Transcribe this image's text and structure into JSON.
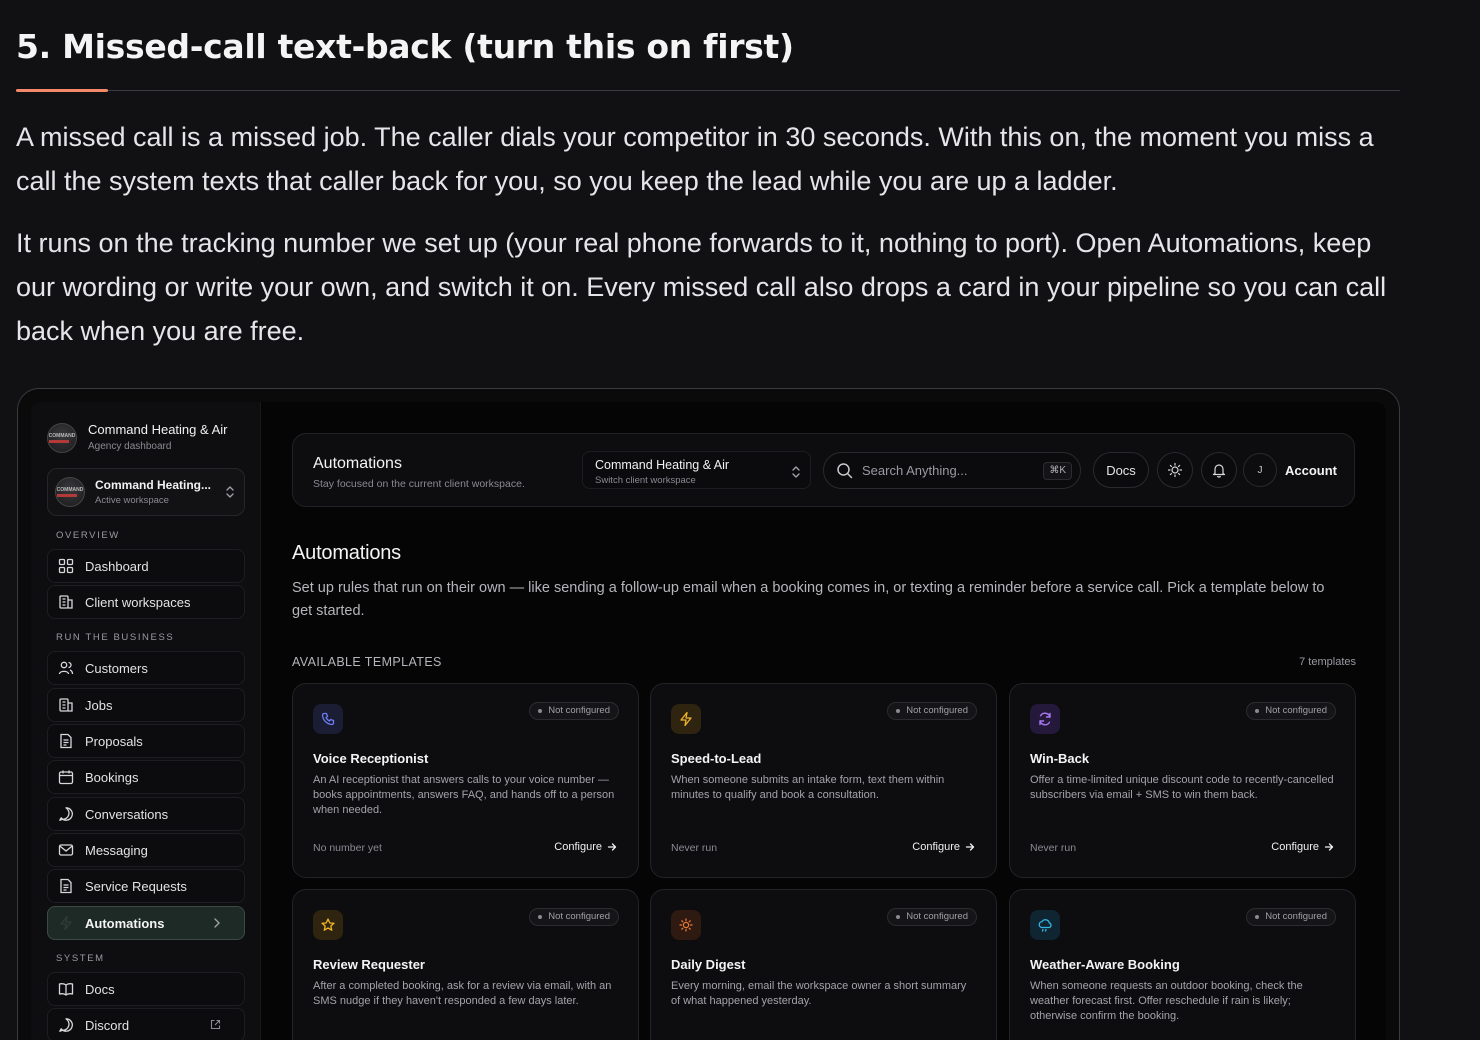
{
  "article": {
    "heading": "5. Missed-call text-back (turn this on first)",
    "p1": "A missed call is a missed job. The caller dials your competitor in 30 seconds. With this on, the moment you miss a call the system texts that caller back for you, so you keep the lead while you are up a ladder.",
    "p2": "It runs on the tracking number we set up (your real phone forwards to it, nothing to port). Open Automations, keep our wording or write your own, and switch it on. Every missed call also drops a card in your pipeline so you can call back when you are free."
  },
  "sidebar": {
    "brand_title": "Command Heating & Air",
    "brand_sub": "Agency dashboard",
    "ws_title": "Command Heating...",
    "ws_sub": "Active workspace",
    "logo_text": "COMMAND",
    "sections": {
      "overview": "OVERVIEW",
      "run": "RUN THE BUSINESS",
      "system": "SYSTEM"
    },
    "items": [
      {
        "label": "Dashboard",
        "icon": "grid-icon"
      },
      {
        "label": "Client workspaces",
        "icon": "building-icon"
      },
      {
        "label": "Customers",
        "icon": "users-icon"
      },
      {
        "label": "Jobs",
        "icon": "building-icon"
      },
      {
        "label": "Proposals",
        "icon": "document-icon"
      },
      {
        "label": "Bookings",
        "icon": "calendar-icon"
      },
      {
        "label": "Conversations",
        "icon": "chat-icon"
      },
      {
        "label": "Messaging",
        "icon": "mail-icon"
      },
      {
        "label": "Service Requests",
        "icon": "document-icon"
      },
      {
        "label": "Automations",
        "icon": "bolt-icon"
      },
      {
        "label": "Docs",
        "icon": "book-icon"
      },
      {
        "label": "Discord",
        "icon": "chat-icon"
      }
    ]
  },
  "topbar": {
    "title": "Automations",
    "subtitle": "Stay focused on the current client workspace.",
    "ws_title": "Command Heating & Air",
    "ws_sub": "Switch client workspace",
    "search_placeholder": "Search Anything...",
    "kbd": "⌘K",
    "docs": "Docs",
    "avatar": "J",
    "account": "Account"
  },
  "main": {
    "heading": "Automations",
    "description": "Set up rules that run on their own — like sending a follow-up email when a booking comes in, or texting a reminder before a service call. Pick a template below to get started.",
    "available": "AVAILABLE TEMPLATES",
    "count": "7 templates"
  },
  "cards": [
    {
      "title": "Voice Receptionist",
      "desc": "An AI receptionist that answers calls to your voice number — books appointments, answers FAQ, and hands off to a person when needed.",
      "badge": "Not configured",
      "foot": "No number yet",
      "action": "Configure",
      "icon": "phone-icon",
      "color": "#6f7cf7",
      "bg": "#1a1d33"
    },
    {
      "title": "Speed-to-Lead",
      "desc": "When someone submits an intake form, text them within minutes to qualify and book a consultation.",
      "badge": "Not configured",
      "foot": "Never run",
      "action": "Configure",
      "icon": "bolt-icon",
      "color": "#f0b429",
      "bg": "#2e2410"
    },
    {
      "title": "Win-Back",
      "desc": "Offer a time-limited unique discount code to recently-cancelled subscribers via email + SMS to win them back.",
      "badge": "Not configured",
      "foot": "Never run",
      "action": "Configure",
      "icon": "refresh-icon",
      "color": "#a678f2",
      "bg": "#24193a"
    },
    {
      "title": "Review Requester",
      "desc": "After a completed booking, ask for a review via email, with an SMS nudge if they haven't responded a few days later.",
      "badge": "Not configured",
      "foot": "",
      "action": "",
      "icon": "star-icon",
      "color": "#f0b429",
      "bg": "#2e2410"
    },
    {
      "title": "Daily Digest",
      "desc": "Every morning, email the workspace owner a short summary of what happened yesterday.",
      "badge": "Not configured",
      "foot": "",
      "action": "",
      "icon": "sun-icon",
      "color": "#f07c3a",
      "bg": "#2e1a10"
    },
    {
      "title": "Weather-Aware Booking",
      "desc": "When someone requests an outdoor booking, check the weather forecast first. Offer reschedule if rain is likely; otherwise confirm the booking.",
      "badge": "Not configured",
      "foot": "",
      "action": "",
      "icon": "cloud-rain-icon",
      "color": "#36b4e0",
      "bg": "#0f2532"
    }
  ]
}
